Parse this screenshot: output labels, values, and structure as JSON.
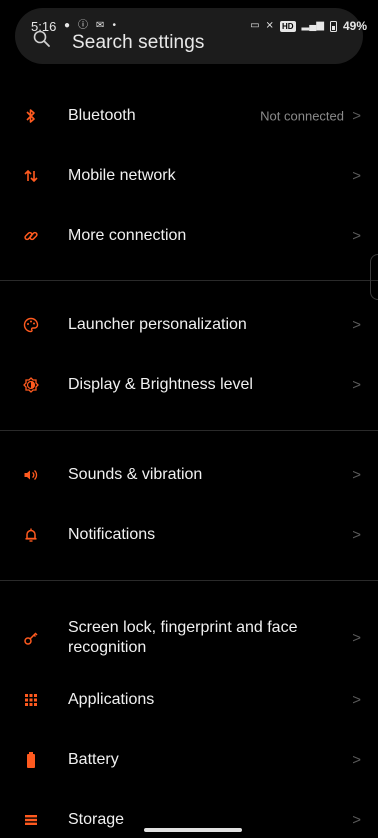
{
  "status_bar": {
    "time": "5:16",
    "battery_percent": "49%",
    "hd_badge": "HD"
  },
  "search": {
    "placeholder": "Search settings"
  },
  "accent_color": "#ff5a1f",
  "settings": {
    "bluetooth": {
      "label": "Bluetooth",
      "value": "Not connected",
      "icon": "bluetooth-icon"
    },
    "mobile_network": {
      "label": "Mobile network",
      "icon": "mobile-data-icon"
    },
    "more_connection": {
      "label": "More connection",
      "icon": "link-icon"
    },
    "launcher": {
      "label": "Launcher personalization",
      "icon": "palette-icon"
    },
    "display": {
      "label": "Display & Brightness level",
      "icon": "brightness-icon"
    },
    "sounds": {
      "label": "Sounds & vibration",
      "icon": "speaker-icon"
    },
    "notifications": {
      "label": "Notifications",
      "icon": "bell-icon"
    },
    "screen_lock": {
      "label": "Screen lock, fingerprint and face recognition",
      "icon": "key-icon"
    },
    "applications": {
      "label": "Applications",
      "icon": "apps-grid-icon"
    },
    "battery": {
      "label": "Battery",
      "icon": "battery-icon"
    },
    "storage": {
      "label": "Storage",
      "icon": "storage-icon"
    }
  },
  "chevron": ">"
}
